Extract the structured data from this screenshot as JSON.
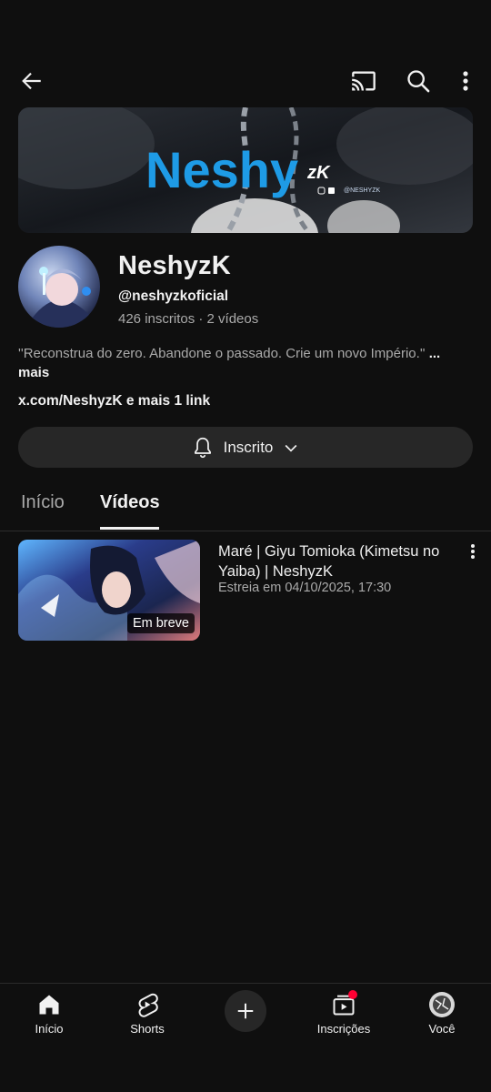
{
  "header": {
    "back_icon": "arrow-left-icon",
    "cast_icon": "cast-icon",
    "search_icon": "search-icon",
    "menu_icon": "more-vert-icon"
  },
  "banner": {
    "brand_text": "Neshy",
    "brand_suffix": "zK",
    "handle_text": "@NESHYZK"
  },
  "channel": {
    "name": "NeshyzK",
    "handle": "@neshyzkoficial",
    "stats": "426 inscritos · 2 vídeos",
    "description": "''Reconstrua do zero. Abandone o passado. Crie um novo Império.''",
    "more": "... mais",
    "link": "x.com/NeshyzK e mais 1 link",
    "subscribe_label": "Inscrito"
  },
  "tabs": [
    {
      "label": "Início",
      "active": false
    },
    {
      "label": "Vídeos",
      "active": true
    }
  ],
  "videos": [
    {
      "title": "Maré | Giyu Tomioka (Kimetsu no Yaiba) | NeshyzK",
      "meta": "Estreia em 04/10/2025, 17:30",
      "badge": "Em breve"
    }
  ],
  "bottom_nav": [
    {
      "label": "Início",
      "icon": "home-icon"
    },
    {
      "label": "Shorts",
      "icon": "shorts-icon"
    },
    {
      "label": "",
      "icon": "create-plus-icon"
    },
    {
      "label": "Inscrições",
      "icon": "subscriptions-icon"
    },
    {
      "label": "Você",
      "icon": "avatar-icon"
    }
  ],
  "colors": {
    "background": "#0f0f0f",
    "surface": "#272727",
    "text_primary": "#f1f1f1",
    "text_secondary": "#aaaaaa",
    "notification_dot": "#ff0033",
    "banner_accent": "#1e9be6"
  }
}
